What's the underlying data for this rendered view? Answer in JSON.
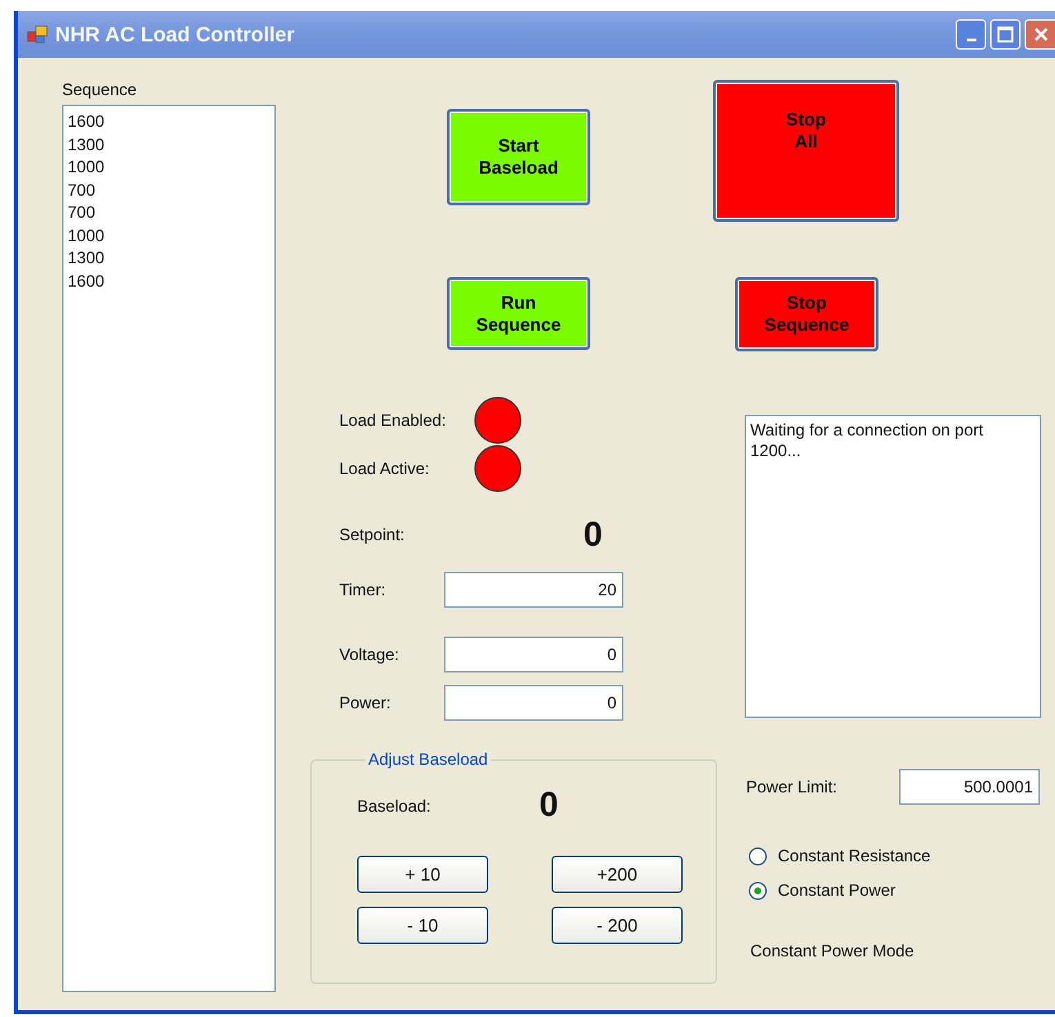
{
  "window": {
    "title": "NHR AC Load Controller"
  },
  "sequence": {
    "label": "Sequence",
    "items": [
      "1600",
      "1300",
      "1000",
      "700",
      "700",
      "1000",
      "1300",
      "1600"
    ]
  },
  "buttons": [
    {
      "kind": "start",
      "label": "Start\nBaseload"
    },
    {
      "kind": "start",
      "label": "Run\nSequence"
    },
    {
      "kind": "stop",
      "label": "Stop\nAll"
    },
    {
      "kind": "stop",
      "label": "Stop\nSequence"
    }
  ],
  "indicators": [
    {
      "label": "Load Enabled:",
      "on": false
    },
    {
      "label": "Load Active:",
      "on": false
    }
  ],
  "setpoint": {
    "label": "Setpoint:",
    "value": "0"
  },
  "fields": [
    {
      "label": "Timer:",
      "value": "20"
    },
    {
      "label": "Voltage:",
      "value": "0"
    },
    {
      "label": "Power:",
      "value": "0"
    }
  ],
  "adjust_baseload": {
    "title": "Adjust Baseload",
    "label": "Baseload:",
    "value": "0",
    "buttons": [
      "+ 10",
      "+200",
      "- 10",
      "- 200"
    ]
  },
  "log": {
    "text": "Waiting for a connection on port 1200..."
  },
  "power_limit": {
    "label": "Power Limit:",
    "value": "500.0001"
  },
  "modes": [
    {
      "label": "Constant Resistance",
      "selected": false
    },
    {
      "label": "Constant Power",
      "selected": true
    }
  ],
  "mode_status": "Constant Power Mode"
}
